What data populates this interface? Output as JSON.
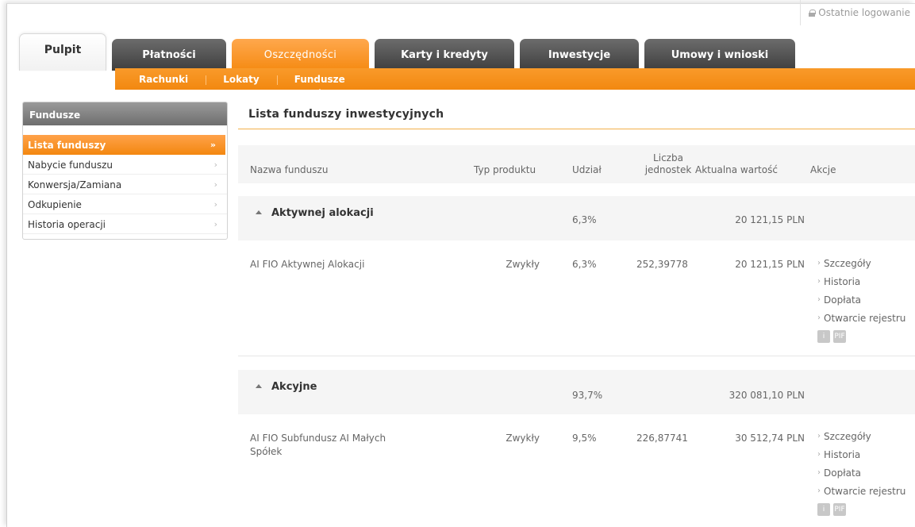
{
  "header": {
    "last_login": "Ostatnie logowanie"
  },
  "tabs": [
    {
      "label": "Pulpit"
    },
    {
      "label": "Płatności"
    },
    {
      "label": "Oszczędności"
    },
    {
      "label": "Karty i kredyty"
    },
    {
      "label": "Inwestycje"
    },
    {
      "label": "Umowy i wnioski"
    }
  ],
  "subnav": [
    {
      "label": "Rachunki"
    },
    {
      "label": "Lokaty"
    },
    {
      "label": "Fundusze"
    }
  ],
  "sidebar": {
    "title": "Fundusze",
    "items": [
      {
        "label": "Lista funduszy",
        "chev": "»"
      },
      {
        "label": "Nabycie funduszu",
        "chev": "›"
      },
      {
        "label": "Konwersja/Zamiana",
        "chev": "›"
      },
      {
        "label": "Odkupienie",
        "chev": "›"
      },
      {
        "label": "Historia operacji",
        "chev": "›"
      }
    ]
  },
  "main": {
    "title": "Lista funduszy inwestycyjnych",
    "columns": {
      "name": "Nazwa funduszu",
      "type": "Typ produktu",
      "share": "Udział",
      "units_l1": "Liczba",
      "units_l2": "jednostek",
      "value": "Aktualna wartość",
      "actions": "Akcje"
    },
    "groups": [
      {
        "name": "Aktywnej alokacji",
        "share": "6,3%",
        "value": "20 121,15 PLN",
        "funds": [
          {
            "name_l1": "AI FIO Aktywnej Alokacji",
            "name_l2": "",
            "type": "Zwykły",
            "share": "6,3%",
            "units": "252,39778",
            "value": "20 121,15 PLN",
            "actions": [
              "Szczegóły",
              "Historia",
              "Dopłata",
              "Otwarcie rejestru"
            ]
          }
        ]
      },
      {
        "name": "Akcyjne",
        "share": "93,7%",
        "value": "320 081,10 PLN",
        "funds": [
          {
            "name_l1": "AI FIO Subfundusz AI Małych",
            "name_l2": "Spółek",
            "type": "Zwykły",
            "share": "9,5%",
            "units": "226,87741",
            "value": "30 512,74 PLN",
            "actions": [
              "Szczegóły",
              "Historia",
              "Dopłata",
              "Otwarcie rejestru"
            ]
          }
        ]
      }
    ],
    "icon_labels": [
      "i",
      "PIF"
    ]
  },
  "colors": {
    "accent": "#f58a12",
    "tab_dark": "#4a4a4a",
    "sidebar_head": "#7d7d7d"
  }
}
